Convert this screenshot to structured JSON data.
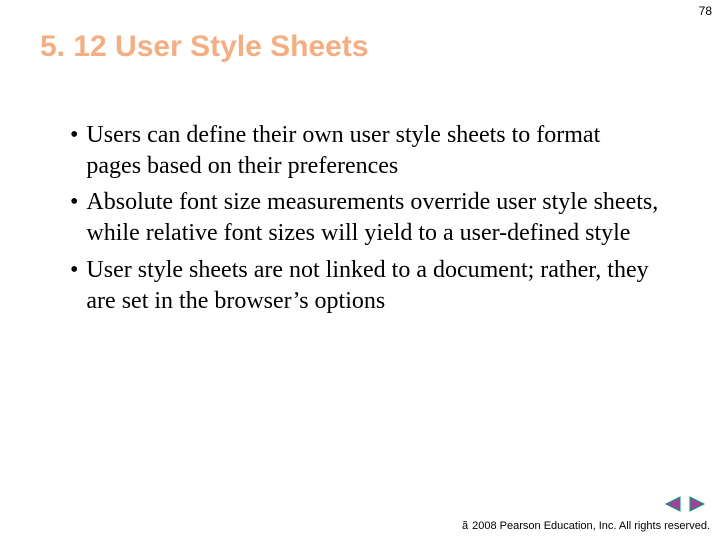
{
  "page_number": "78",
  "title": "5. 12 User Style Sheets",
  "bullets": [
    "Users can define their own user style sheets to format pages based on their preferences",
    "Absolute font size measurements override user style sheets, while relative font sizes will yield to a user-defined style",
    "User style sheets are not linked to a document; rather, they are set in the browser’s options"
  ],
  "footer": {
    "copyright_symbol": "ã",
    "text": "2008 Pearson Education, Inc.  All rights reserved."
  },
  "nav": {
    "prev_color": "#a040a0",
    "next_color": "#a040a0",
    "outline": "#00a060"
  }
}
